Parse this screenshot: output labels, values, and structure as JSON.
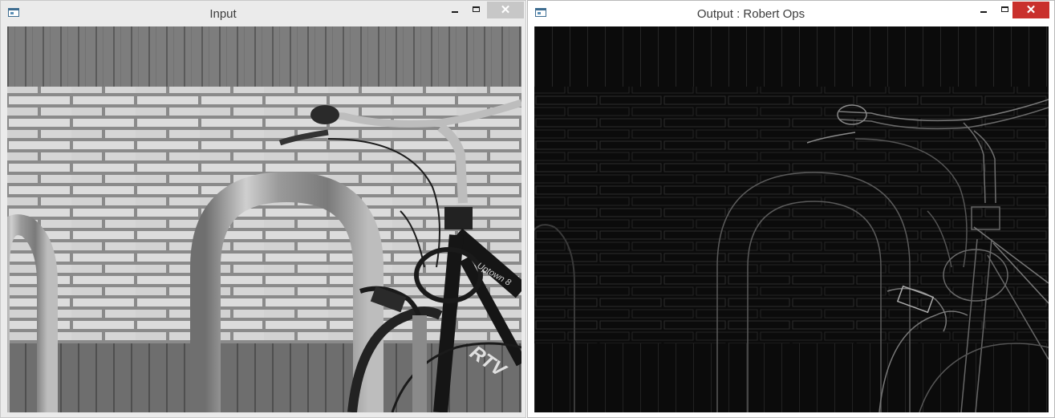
{
  "windows": [
    {
      "title": "Input",
      "state": "inactive",
      "icon": "opencv-window-icon",
      "controls": {
        "minimize": "minimize-icon",
        "maximize": "maximize-icon",
        "close": "✕"
      },
      "image": {
        "description_type": "grayscale photo",
        "subject": "bicycle-rack"
      }
    },
    {
      "title": "Output : Robert Ops",
      "state": "active",
      "icon": "opencv-window-icon",
      "controls": {
        "minimize": "minimize-icon",
        "maximize": "maximize-icon",
        "close": "✕"
      },
      "image": {
        "description_type": "edge-detected photo",
        "subject": "bicycle-rack"
      }
    }
  ],
  "colors": {
    "close_active": "#c9302c",
    "close_inactive": "#c7c7c7",
    "input_wall_light": "#d9d9d9",
    "output_bg": "#0b0b0b"
  },
  "photo_text": {
    "frame_brand": "Uptown 8",
    "frame_lettering": "RTV"
  }
}
